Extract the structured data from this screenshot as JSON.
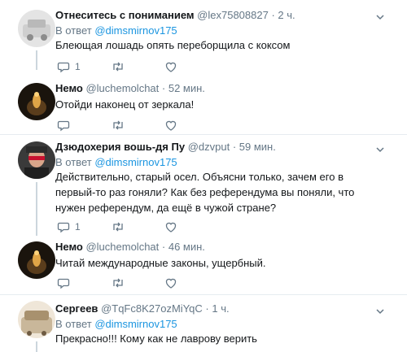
{
  "tweets": [
    {
      "name": "Отнеситесь с пониманием",
      "handle": "@lex75808827",
      "sep": "·",
      "time": "2 ч.",
      "reply_prefix": "В ответ ",
      "reply_user": "@dimsmirnov175",
      "text": "Блеющая лошадь опять переборщила с коксом",
      "reply_count": "1",
      "retweet_count": "",
      "like_count": ""
    },
    {
      "name": "Немо",
      "handle": "@luchemolchat",
      "sep": "·",
      "time": "52 мин.",
      "text": "Отойди наконец от зеркала!"
    },
    {
      "name": "Дзюдохерия вошь-дя Пу",
      "handle": "@dzvput",
      "sep": "·",
      "time": "59 мин.",
      "reply_prefix": "В ответ ",
      "reply_user": "@dimsmirnov175",
      "text": "Действительно, старый осел. Объясни только, зачем его в первый-то раз гоняли? Как без референдума вы поняли, что нужен референдум, да ещё в чужой стране?",
      "reply_count": "1"
    },
    {
      "name": "Немо",
      "handle": "@luchemolchat",
      "sep": "·",
      "time": "46 мин.",
      "text": "Читай международные законы, ущербный."
    },
    {
      "name": "Сергеев",
      "handle": "@TqFc8K27ozMiYqC",
      "sep": "·",
      "time": "1 ч.",
      "reply_prefix": "В ответ ",
      "reply_user": "@dimsmirnov175",
      "text": "Прекрасно!!! Кому как не лаврову верить"
    }
  ],
  "colors": {
    "link": "#1b95e0",
    "muted": "#657786",
    "divider": "#e6ecf0"
  },
  "icons": [
    "reply-icon",
    "retweet-icon",
    "like-icon",
    "chevron-down-icon"
  ]
}
